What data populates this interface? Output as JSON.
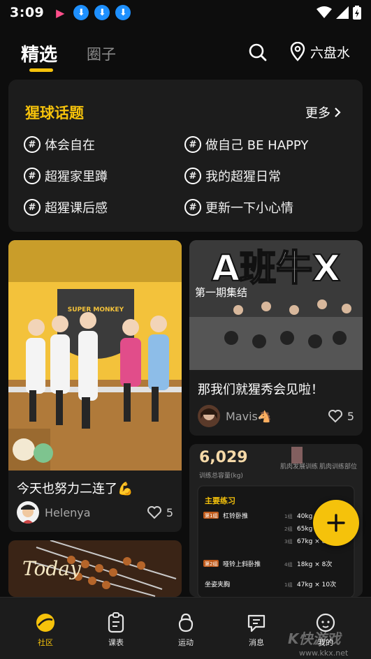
{
  "status": {
    "time": "3:09"
  },
  "tabs": {
    "active": "精选",
    "inactive": "圈子"
  },
  "location": "六盘水",
  "topics": {
    "title": "猩球话题",
    "more": "更多",
    "items": [
      "体会自在",
      "做自己 BE HAPPY",
      "超猩家里蹲",
      "我的超猩日常",
      "超猩课后感",
      "更新一下小心情"
    ]
  },
  "posts": [
    {
      "title": "今天也努力二连了💪",
      "author": "Helenya",
      "likes": "5",
      "image_text": "SUPER MONKEY"
    },
    {
      "title": "那我们就猩秀会见啦！",
      "author": "Mavis🐴",
      "likes": "5",
      "image_text": "A班牛X",
      "image_subtext": "第一期集结"
    },
    {
      "stats_value": "6,029",
      "stats_label1": "训练总容量(kg)",
      "stats_label2": "肌肉发展训练",
      "stats_label3": "肌肉训练部位",
      "section": "主要练习",
      "exercises": [
        {
          "tag": "第1组",
          "name": "杠铃卧推",
          "sets": [
            "40kg × 12次",
            "65kg × 8次",
            "67kg × 8次"
          ],
          "set_labels": [
            "1组",
            "2组",
            "3组"
          ]
        },
        {
          "tag": "第2组",
          "name": "哑铃上斜卧推",
          "sets": [
            "18kg × 8次"
          ],
          "set_labels": [
            "4组"
          ]
        },
        {
          "tag": "",
          "name": "坐姿夹胸",
          "sets": [
            "47kg × 10次"
          ],
          "set_labels": [
            "1组"
          ]
        }
      ]
    },
    {
      "image_text": "Today"
    }
  ],
  "bottom_nav": [
    "社区",
    "课表",
    "运动",
    "消息",
    "我的"
  ],
  "watermark": {
    "main": "K快游戏",
    "url": "www.kkx.net"
  },
  "colors": {
    "accent": "#f5c20b",
    "card": "#1c1c1c",
    "background": "#0d0d0d"
  }
}
